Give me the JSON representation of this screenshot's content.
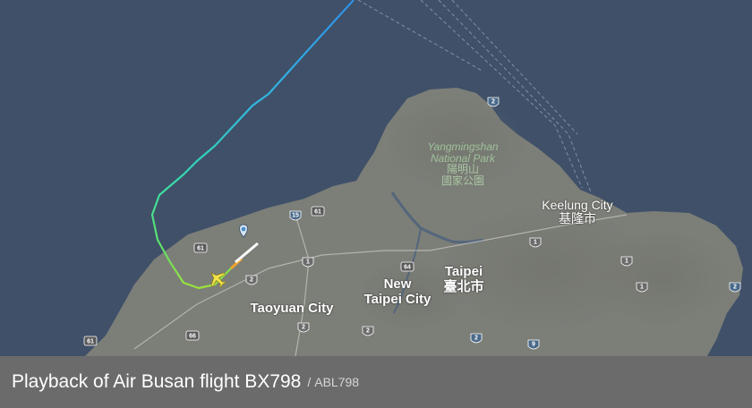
{
  "footer": {
    "title": "Playback of Air Busan flight BX798",
    "separator": "/",
    "callsign": "ABL798"
  },
  "places": {
    "yangmingshan": {
      "en_line1": "Yangmingshan",
      "en_line2": "National Park",
      "zh_line1": "陽明山",
      "zh_line2": "國家公園"
    },
    "keelung": {
      "en": "Keelung City",
      "zh": "基隆市"
    },
    "taipei": {
      "en": "Taipei",
      "zh": "臺北市"
    },
    "new_taipei": {
      "line1": "New",
      "line2": "Taipei City"
    },
    "taoyuan": {
      "en": "Taoyuan City"
    }
  },
  "route_shields": [
    "2",
    "61",
    "15",
    "61",
    "1",
    "2",
    "64",
    "1",
    "1",
    "2",
    "66",
    "61",
    "2",
    "9",
    "2",
    "2",
    "1"
  ],
  "colors": {
    "sea": "#3f5068",
    "land": "#7c7e78",
    "footer": "#6b6b6b",
    "track_high": "#3aa0e8",
    "track_mid": "#34d2b8",
    "track_low": "#7ee04a",
    "aircraft": "#f1e24a"
  },
  "icons": {
    "aircraft": "airplane-icon",
    "airport": "airport-pin-icon"
  }
}
